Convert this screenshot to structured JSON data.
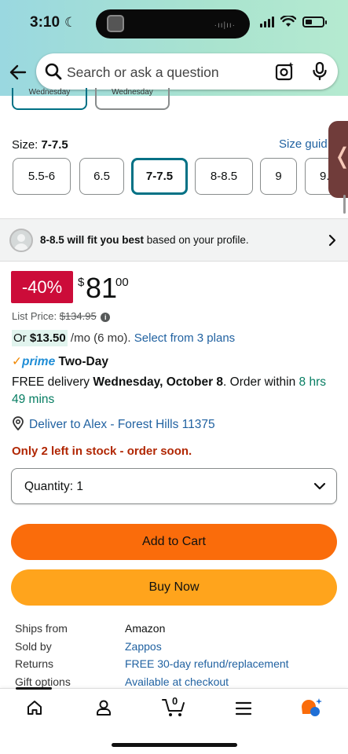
{
  "status_bar": {
    "time": "3:10"
  },
  "search": {
    "placeholder": "Search or ask a question"
  },
  "delivery_days": {
    "left": "Wednesday",
    "right": "Wednesday"
  },
  "size": {
    "label": "Size: ",
    "selected": "7-7.5",
    "guide_link": "Size guid",
    "options": [
      "5.5-6",
      "6.5",
      "7-7.5",
      "8-8.5",
      "9",
      "9."
    ]
  },
  "fit": {
    "recommendation_bold": "8-8.5 will fit you best",
    "recommendation_rest": " based on your profile."
  },
  "pricing": {
    "discount": "-40%",
    "currency": "$",
    "price_whole": "81",
    "price_fraction": "00",
    "list_price_label": "List Price: ",
    "list_price": "$134.95",
    "plan_prefix": "Or ",
    "plan_amount": "$13.50",
    "plan_term": " /mo (6 mo).",
    "plan_link": " Select from 3 plans"
  },
  "shipping": {
    "prime_check": "✓",
    "prime_label": "prime",
    "prime_speed": "Two-Day",
    "free_delivery": "FREE delivery ",
    "delivery_date": "Wednesday, October 8",
    "order_within": ". Order within ",
    "countdown": "8 hrs 49 mins",
    "deliver_to": "Deliver to Alex - Forest Hills 11375",
    "stock_notice": "Only 2 left in stock - order soon."
  },
  "quantity": {
    "label": "Quantity: 1"
  },
  "actions": {
    "add_to_cart": "Add to Cart",
    "buy_now": "Buy Now"
  },
  "details": {
    "ships_from_label": "Ships from",
    "ships_from": "Amazon",
    "sold_by_label": "Sold by",
    "sold_by": "Zappos",
    "returns_label": "Returns",
    "returns": "FREE 30-day refund/replacement",
    "gift_label": "Gift options",
    "gift": "Available at checkout"
  },
  "nav": {
    "cart_count": "0"
  },
  "colors": {
    "deal_red": "#cc0c39",
    "add_to_cart": "#fa6c0b",
    "buy_now": "#ffa41c",
    "link_blue": "#2162a1",
    "selected_teal": "#007185",
    "stock_red": "#b12704",
    "prime_blue": "#1f8dd6",
    "countdown_green": "#067d62"
  }
}
